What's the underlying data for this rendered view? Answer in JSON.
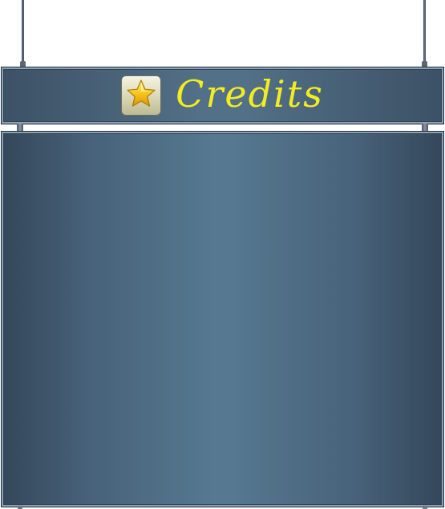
{
  "title_sign": {
    "icon": "star-icon",
    "title": "Credits"
  },
  "colors": {
    "title_text": "#f3ec22",
    "panel_center": "#567891",
    "panel_edge": "#34475a",
    "frame_highlight": "#8aa0b4"
  }
}
